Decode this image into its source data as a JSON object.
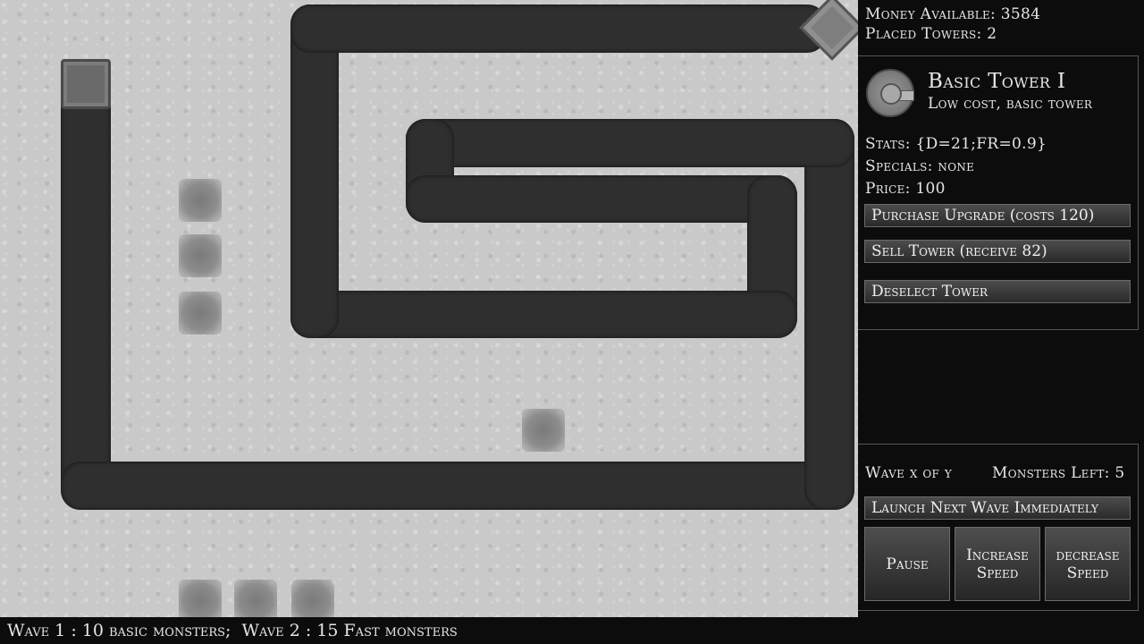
{
  "stats": {
    "money": "Money Available: 3584",
    "towers": "Placed Towers: 2"
  },
  "selected_tower": {
    "icon": "turret-icon",
    "name": "Basic Tower I",
    "description": "Low cost, basic tower",
    "stats": "Stats: {D=21;FR=0.9}",
    "specials": "Specials: none",
    "price": "Price: 100",
    "upgrade_label": "Purchase Upgrade (costs 120)",
    "sell_label": "Sell Tower (receive 82)",
    "deselect_label": "Deselect Tower"
  },
  "wave": {
    "status": "Wave x of y",
    "monsters_left": "Monsters Left: 5",
    "launch_label": "Launch Next Wave Immediately"
  },
  "controls": {
    "pause_label": "Pause",
    "increase_label": "Increase Speed",
    "decrease_label": "decrease Speed"
  },
  "footer": {
    "wave_info": "Wave 1 : 10 basic monsters;  Wave 2 : 15 Fast monsters"
  }
}
